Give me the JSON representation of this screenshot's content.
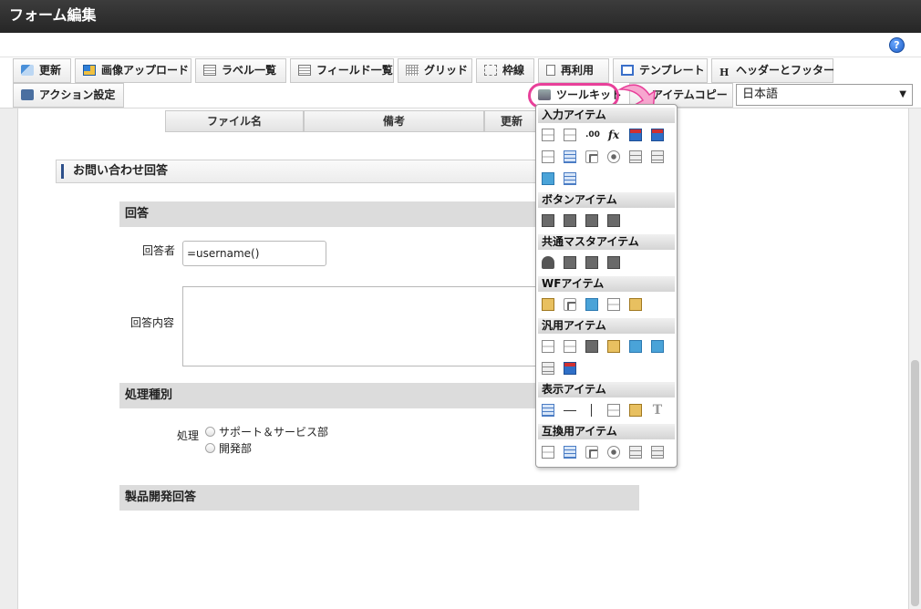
{
  "window": {
    "title": "フォーム編集"
  },
  "help": {
    "glyph": "?"
  },
  "toolbar": {
    "row1": [
      {
        "key": "update",
        "label": "更新",
        "icon": "update-icon"
      },
      {
        "key": "image-upload",
        "label": "画像アップロード",
        "icon": "image-icon"
      },
      {
        "key": "label-list",
        "label": "ラベル一覧",
        "icon": "list-icon"
      },
      {
        "key": "field-list",
        "label": "フィールド一覧",
        "icon": "list-icon"
      },
      {
        "key": "grid",
        "label": "グリッド",
        "icon": "grid-icon"
      },
      {
        "key": "frame-line",
        "label": "枠線",
        "icon": "frame-icon"
      },
      {
        "key": "reuse",
        "label": "再利用",
        "icon": "document-icon"
      },
      {
        "key": "template",
        "label": "テンプレート",
        "icon": "template-icon"
      },
      {
        "key": "header-footer",
        "label": "ヘッダーとフッター",
        "icon": "header-icon"
      }
    ],
    "row2": [
      {
        "key": "action-settings",
        "label": "アクション設定",
        "icon": "action-icon"
      },
      {
        "key": "toolkit",
        "label": "ツールキット",
        "icon": "toolkit-icon"
      },
      {
        "key": "item-copy",
        "label": "アイテムコピー",
        "icon": "copy-icon"
      }
    ],
    "language": {
      "selected": "日本語",
      "arrow": "▼"
    }
  },
  "file_table": {
    "headers": [
      "ファイル名",
      "備考",
      "更新"
    ]
  },
  "form": {
    "section_title": "お問い合わせ回答",
    "answer_section": "回答",
    "respondent_label": "回答者",
    "respondent_value": "=username()",
    "content_label": "回答内容",
    "processing_section": "処理種別",
    "processing_label": "処理",
    "radio_options": [
      "サポート＆サービス部",
      "開発部"
    ],
    "product_section": "製品開発回答"
  },
  "toolkit_popup": {
    "groups": [
      {
        "title": "入力アイテム",
        "icons": [
          "text-field-icon",
          "text-field-icon",
          "decimal-icon",
          "formula-icon",
          "calendar-icon",
          "calendar-icon",
          "combo-box-icon",
          "list-box-icon",
          "checkbox-icon",
          "radio-icon",
          "select-list-icon",
          "select-list-icon",
          "upload-icon",
          "table-icon"
        ],
        "glyphs": {
          "decimal-icon": ".00",
          "formula-icon": "fx"
        }
      },
      {
        "title": "ボタンアイテム",
        "icons": [
          "submit-button-icon",
          "arrow-right-icon",
          "arrow-left-icon",
          "arrow-left-back-icon"
        ]
      },
      {
        "title": "共通マスタアイテム",
        "icons": [
          "user-icon",
          "building-icon",
          "organization-icon",
          "organization-icon"
        ]
      },
      {
        "title": "WFアイテム",
        "icons": [
          "clipboard-icon",
          "attachment-icon",
          "image-icon",
          "history-icon",
          "stamp-icon"
        ]
      },
      {
        "title": "汎用アイテム",
        "icons": [
          "separator-icon",
          "document-icon",
          "camera-icon",
          "key-icon",
          "upload-file-icon",
          "download-file-icon",
          "sidebar-icon",
          "picture-icon"
        ]
      },
      {
        "title": "表示アイテム",
        "icons": [
          "label-box-icon",
          "horizontal-line-icon",
          "vertical-line-icon",
          "blank-box-icon",
          "image-box-icon",
          "text-icon"
        ],
        "glyphs": {
          "text-icon": "T"
        }
      },
      {
        "title": "互換用アイテム",
        "icons": [
          "combo-box-icon",
          "list-box-icon",
          "checkbox-icon",
          "radio-icon",
          "select-list-icon",
          "select-list-icon"
        ]
      }
    ]
  },
  "colors": {
    "titlebar": "#262626",
    "accent_highlight": "#e8409a",
    "section_marker": "#2d4f8a"
  }
}
